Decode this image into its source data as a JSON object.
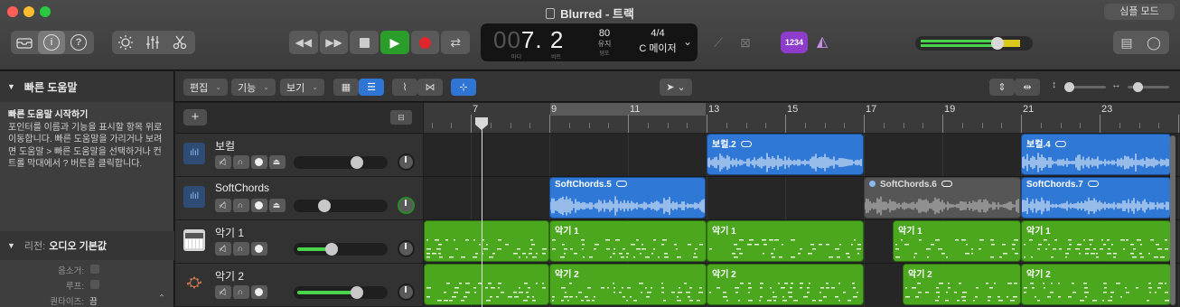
{
  "window": {
    "title": "Blurred - 트랙",
    "simple_mode_label": "심플 모드"
  },
  "lcd": {
    "bar_dim": "00",
    "bar": "7",
    "beat": "2",
    "cap_bar": "마디",
    "cap_beat": "비트",
    "tempo": "80",
    "tempo_sub": "유지",
    "tempo_cap": "템포",
    "time_sig": "4/4",
    "key": "C 메이저"
  },
  "count_in_label": "1234",
  "quick_help": {
    "header": "빠른 도움말",
    "title": "빠른 도움말 시작하기",
    "body": "포인터를 이름과 기능을 표시할 항목 위로 이동합니다. 빠른 도움말을 가리거나 보려면 도움말 > 빠른 도움말을 선택하거나 컨트롤 막대에서 ? 버튼을 클릭합니다."
  },
  "region_inspector": {
    "label": "리전:",
    "value": "오디오 기본값",
    "rows": [
      {
        "label": "음소거:"
      },
      {
        "label": "루프:"
      },
      {
        "label": "퀀타이즈:",
        "value": "끔"
      }
    ]
  },
  "tracks_toolbar": {
    "edit": "편집",
    "functions": "기능",
    "view": "보기"
  },
  "ruler": {
    "bars": [
      "7",
      "9",
      "11",
      "13",
      "15",
      "17",
      "19",
      "21",
      "23"
    ]
  },
  "tracks": [
    {
      "name": "보컬",
      "type": "audio",
      "volume": 0.72
    },
    {
      "name": "SoftChords",
      "type": "audio",
      "volume": 0.28
    },
    {
      "name": "악기 1",
      "type": "software",
      "volume": 0.38
    },
    {
      "name": "악기 2",
      "type": "drum",
      "volume": 0.72
    }
  ],
  "regions": {
    "vocal": [
      "보컬.2",
      "보컬.4"
    ],
    "softchords": [
      "SoftChords.5",
      "SoftChords.6",
      "SoftChords.7"
    ],
    "inst1": [
      "악기 1",
      "악기 1",
      "악기 1",
      "악기 1"
    ],
    "inst2": [
      "악기 2",
      "악기 2",
      "악기 2",
      "악기 2"
    ]
  },
  "colors": {
    "audio_region": "#2f78d6",
    "midi_region": "#4aa71e",
    "muted_region": "#565656",
    "accent": "#2f75d3"
  }
}
